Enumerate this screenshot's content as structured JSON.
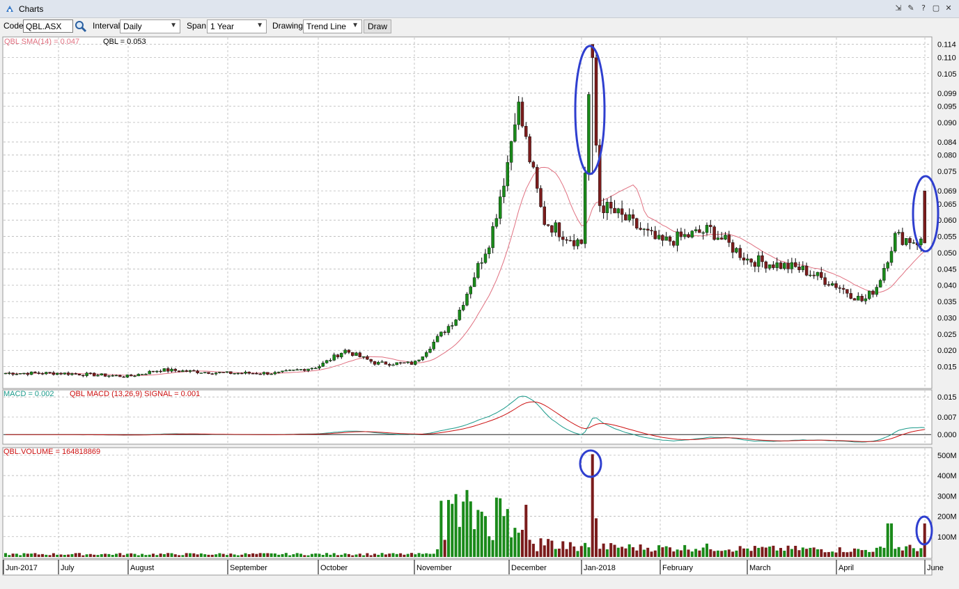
{
  "window": {
    "title": "Charts",
    "buttons": [
      "minimize-icon",
      "settings-icon",
      "help-icon",
      "maximize-icon",
      "close-icon"
    ]
  },
  "toolbar": {
    "code_label": "Code",
    "code_value": "QBL.ASX",
    "interval_label": "Interval",
    "interval_value": "Daily",
    "span_label": "Span",
    "span_value": "1 Year",
    "drawing_label": "Drawing",
    "drawing_value": "Trend Line",
    "draw_button": "Draw"
  },
  "price_panel": {
    "sma_label": "QBL SMA(14) = 0.047",
    "price_label": "QBL = 0.053",
    "y_ticks": [
      "0.114",
      "0.110",
      "0.105",
      "0.099",
      "0.095",
      "0.090",
      "0.084",
      "0.080",
      "0.075",
      "0.069",
      "0.065",
      "0.060",
      "0.055",
      "0.050",
      "0.045",
      "0.040",
      "0.035",
      "0.030",
      "0.025",
      "0.020",
      "0.015"
    ]
  },
  "macd_panel": {
    "macd_label": "MACD = 0.002",
    "signal_label": "QBL MACD (13,26,9) SIGNAL = 0.001",
    "y_ticks": [
      "0.015",
      "0.007",
      "0.000"
    ]
  },
  "volume_panel": {
    "volume_label": "QBL.VOLUME = 164818869",
    "y_ticks": [
      "500M",
      "400M",
      "300M",
      "200M",
      "100M"
    ]
  },
  "x_axis": {
    "labels": [
      "Jun-2017",
      "July",
      "August",
      "September",
      "October",
      "November",
      "December",
      "Jan-2018",
      "February",
      "March",
      "April",
      "June"
    ]
  },
  "colors": {
    "up": "#1a8a1a",
    "down": "#7b1c1c",
    "sma": "#e07080",
    "macd": "#1a9a8a",
    "signal": "#cc1010",
    "highlight": "#2f3fcf"
  },
  "chart_data": {
    "type": "candlestick",
    "price_anchors": [
      [
        "Jun-2017",
        0.013
      ],
      [
        "July",
        0.013
      ],
      [
        "August",
        0.012
      ],
      [
        "Aug-late",
        0.014
      ],
      [
        "September",
        0.013
      ],
      [
        "Sep-late",
        0.013
      ],
      [
        "October",
        0.015
      ],
      [
        "Oct-mid",
        0.02
      ],
      [
        "Oct-late",
        0.016
      ],
      [
        "November",
        0.016
      ],
      [
        "Nov-mid",
        0.03
      ],
      [
        "Nov-late",
        0.055
      ],
      [
        "December",
        0.08
      ],
      [
        "Dec-peak",
        0.097
      ],
      [
        "Dec-mid",
        0.06
      ],
      [
        "Dec-late",
        0.055
      ],
      [
        "Jan-2018",
        0.053
      ],
      [
        "Jan-spike",
        0.114
      ],
      [
        "Jan-mid",
        0.065
      ],
      [
        "Jan-late",
        0.06
      ],
      [
        "February",
        0.053
      ],
      [
        "Feb-mid",
        0.057
      ],
      [
        "March",
        0.048
      ],
      [
        "Mar-late",
        0.045
      ],
      [
        "April",
        0.04
      ],
      [
        "Apr-low",
        0.035
      ],
      [
        "Apr-late",
        0.04
      ],
      [
        "May",
        0.055
      ],
      [
        "June",
        0.053
      ]
    ],
    "sma_period": 14,
    "sma_value": 0.047,
    "macd_value": 0.002,
    "signal_value": 0.001,
    "volume_last": 164818869
  }
}
